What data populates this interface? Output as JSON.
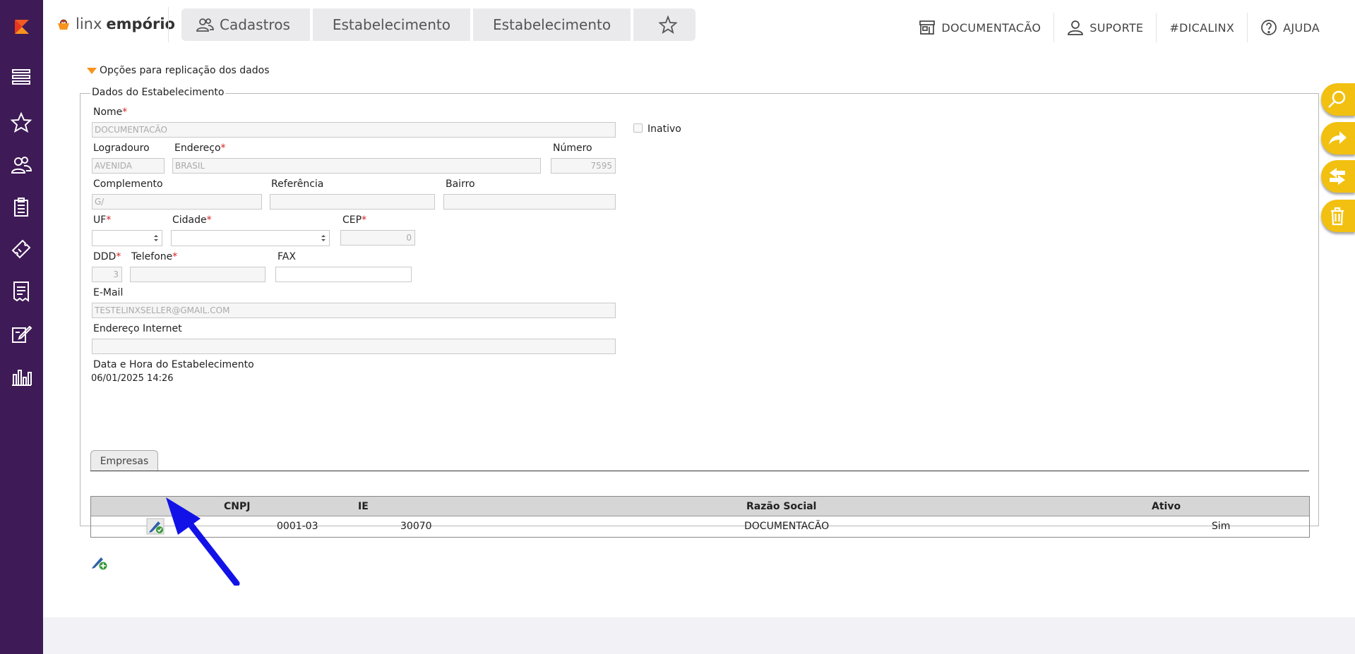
{
  "brand": {
    "prefix": "linx",
    "name": "empório"
  },
  "breadcrumb": [
    "Cadastros",
    "Estabelecimento",
    "Estabelecimento"
  ],
  "top_menu": [
    "DOCUMENTACÃO",
    "SUPORTE",
    "#DICALINX",
    "AJUDA"
  ],
  "replication_toggle": "Opções para replicação dos dados",
  "section_title": "Dados do Estabelecimento",
  "fields": {
    "nome": {
      "label": "Nome",
      "value": "DOCUMENTACÃO"
    },
    "inativo": {
      "label": "Inativo",
      "checked": false
    },
    "logradouro": {
      "label": "Logradouro",
      "value": "AVENIDA"
    },
    "endereco": {
      "label": "Endereço",
      "value": "BRASIL"
    },
    "numero": {
      "label": "Número",
      "value": "7595"
    },
    "complemento": {
      "label": "Complemento",
      "value": "G/"
    },
    "referencia": {
      "label": "Referência",
      "value": ""
    },
    "bairro": {
      "label": "Bairro",
      "value": ""
    },
    "uf": {
      "label": "UF",
      "value": ""
    },
    "cidade": {
      "label": "Cidade",
      "value": ""
    },
    "cep": {
      "label": "CEP",
      "value": "0"
    },
    "ddd": {
      "label": "DDD",
      "value": "3"
    },
    "telefone": {
      "label": "Telefone",
      "value": ""
    },
    "fax": {
      "label": "FAX",
      "value": ""
    },
    "email": {
      "label": "E-Mail",
      "value": "TESTELINXSELLER@GMAIL.COM"
    },
    "endereco_internet": {
      "label": "Endereço Internet",
      "value": ""
    },
    "data_hora": {
      "label": "Data e Hora do Estabelecimento",
      "value": "06/01/2025 14:26"
    }
  },
  "tabs": [
    "Empresas"
  ],
  "grid": {
    "columns": [
      "CNPJ",
      "IE",
      "Razão Social",
      "Ativo"
    ],
    "rows": [
      {
        "cnpj": "0001-03",
        "ie": "30070",
        "razao_social": "DOCUMENTACÃO",
        "ativo": "Sim"
      }
    ]
  },
  "colors": {
    "sidebar": "#3e1a56",
    "accent": "#f2c010",
    "brand_orange": "#f7941d",
    "arrow": "#1212e8"
  }
}
